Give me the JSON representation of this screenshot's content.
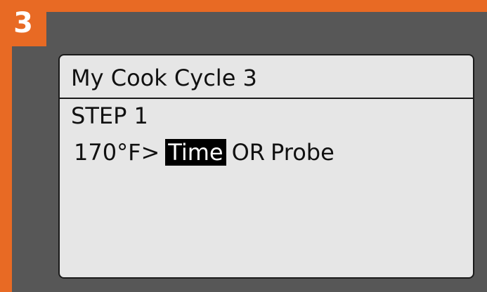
{
  "step_badge": "3",
  "screen": {
    "title": "My Cook Cycle 3",
    "step_label": "STEP 1",
    "temperature": "170°F",
    "arrow": ">",
    "time_option": "Time",
    "or_label": "OR",
    "probe_option": "Probe"
  },
  "colors": {
    "accent": "#e86a24",
    "panel": "#575757",
    "screen_bg": "#e6e6e6",
    "highlight_bg": "#000000"
  }
}
